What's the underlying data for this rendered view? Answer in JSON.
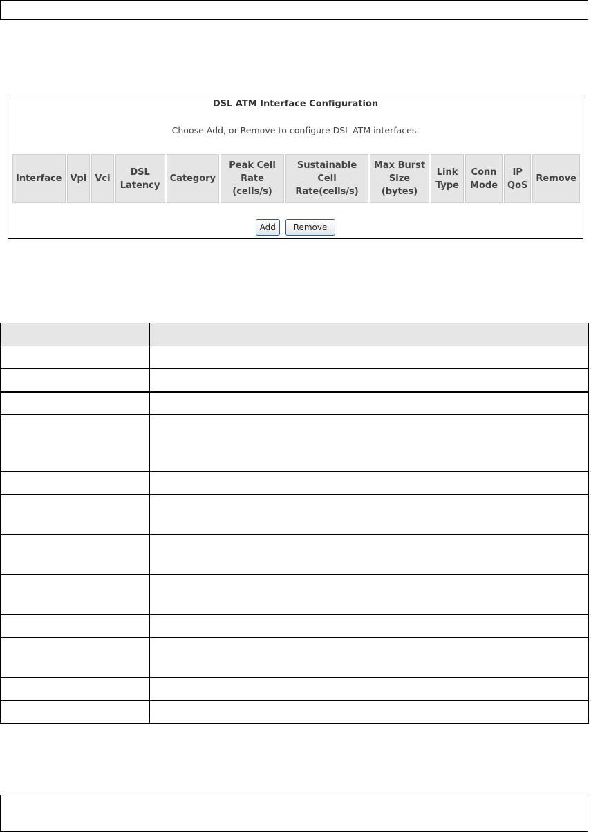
{
  "atm_panel": {
    "title": "DSL ATM Interface Configuration",
    "subtitle": "Choose Add, or Remove to configure DSL ATM interfaces.",
    "columns": {
      "interface": "Interface",
      "vpi": "Vpi",
      "vci": "Vci",
      "dsl_latency_1": "DSL",
      "dsl_latency_2": "Latency",
      "category": "Category",
      "pcr_1": "Peak Cell",
      "pcr_2": "Rate",
      "pcr_3": "(cells/s)",
      "scr_1": "Sustainable Cell",
      "scr_2": "Rate(cells/s)",
      "mbs_1": "Max Burst",
      "mbs_2": "Size",
      "mbs_3": "(bytes)",
      "link_type_1": "Link",
      "link_type_2": "Type",
      "conn_mode_1": "Conn",
      "conn_mode_2": "Mode",
      "ip_qos_1": "IP",
      "ip_qos_2": "QoS",
      "remove": "Remove"
    },
    "buttons": {
      "add": "Add",
      "remove": "Remove"
    }
  }
}
